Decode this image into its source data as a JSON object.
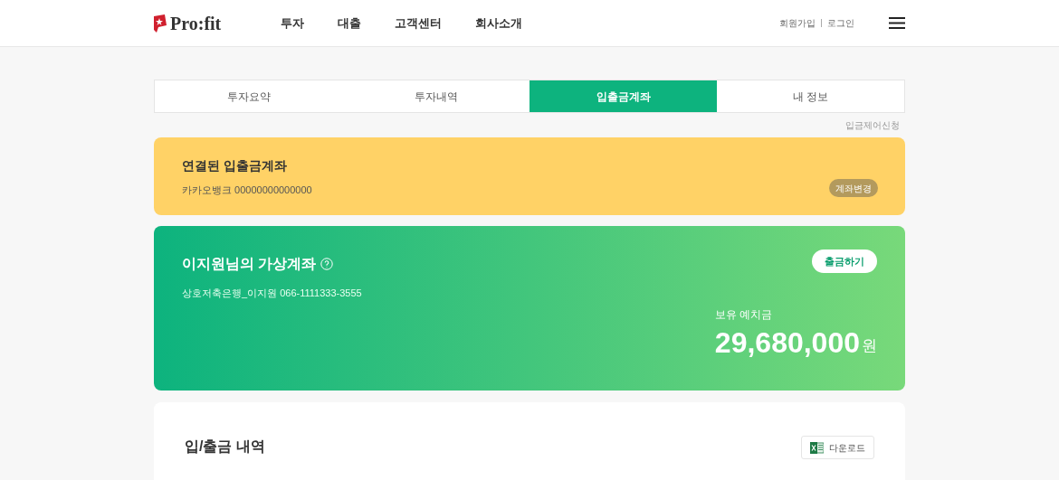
{
  "header": {
    "logo": "Pro:fit",
    "nav": [
      "투자",
      "대출",
      "고객센터",
      "회사소개"
    ],
    "auth_links": [
      "회원가입",
      "로그인"
    ]
  },
  "tabs": [
    {
      "label": "투자요약",
      "selected": false
    },
    {
      "label": "투자내역",
      "selected": false
    },
    {
      "label": "입출금계좌",
      "selected": true
    },
    {
      "label": "내 정보",
      "selected": false
    }
  ],
  "deposit_control_link": "입금제어신청",
  "linked_account": {
    "title": "연결된 입출금계좌",
    "bank": "카카오뱅크",
    "number": "00000000000000",
    "button": "계좌변경"
  },
  "virtual_account": {
    "title": "이지원님의 가상계좌",
    "bank": "상호저축은행_이지원",
    "number": "066-1111333-3555",
    "button": "출금하기",
    "balance_label": "보유 예치금",
    "balance": "29,680,000",
    "unit": "원"
  },
  "history": {
    "title": "입/출금 내역",
    "download": "다운로드"
  }
}
